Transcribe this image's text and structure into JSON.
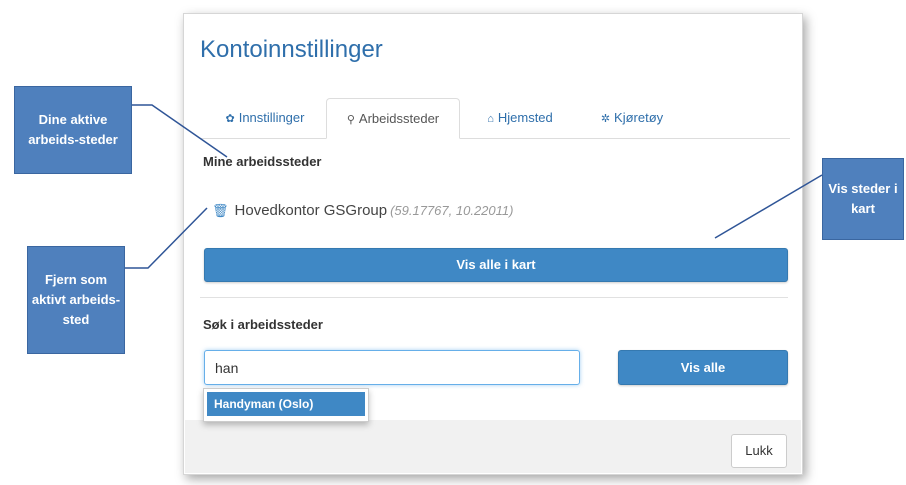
{
  "modal": {
    "title": "Kontoinnstillinger",
    "tabs": [
      {
        "label": "Innstillinger",
        "icon": "gear-icon",
        "active": false
      },
      {
        "label": "Arbeidssteder",
        "icon": "map-marker-icon",
        "active": true
      },
      {
        "label": "Hjemsted",
        "icon": "home-icon",
        "active": false
      },
      {
        "label": "Kjøretøy",
        "icon": "gears-icon",
        "active": false
      }
    ],
    "mine_heading": "Mine arbeidssteder",
    "workplace": {
      "name": "Hovedkontor GSGroup",
      "coords": "(59.17767, 10.22011)",
      "icon": "trash-icon"
    },
    "show_all_map_label": "Vis alle i kart",
    "search_heading": "Søk i arbeidssteder",
    "search_value": "han",
    "search_button_label": "Vis alle",
    "suggestion": "Handyman (Oslo)",
    "close_label": "Lukk"
  },
  "callouts": {
    "active_workplaces": "Dine aktive arbeids-steder",
    "remove_active": "Fjern som aktivt arbeids-sted",
    "show_in_map": "Vis steder i kart"
  },
  "colors": {
    "accent": "#3f88c5",
    "title": "#2f6fab",
    "callout": "#4f80bd"
  }
}
